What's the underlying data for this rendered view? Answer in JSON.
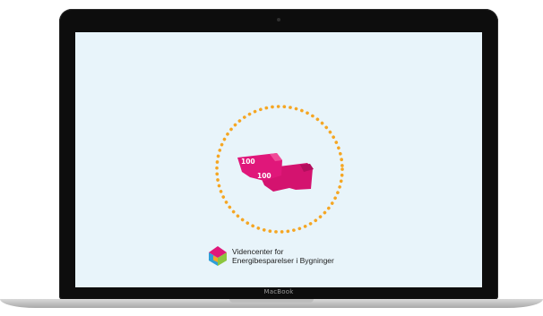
{
  "device": {
    "brand_label": "MacBook"
  },
  "slide": {
    "banknote_front_value": "100",
    "banknote_back_value": "100"
  },
  "logo": {
    "line1": "Videncenter for",
    "line2": "Energibesparelser i Bygninger"
  },
  "colors": {
    "screen_background": "#e8f4fa",
    "dotted_circle": "#f5a623",
    "banknote": "#e0177a"
  },
  "icons": [
    "dotted-circle-icon",
    "banknotes-icon",
    "house-logo-icon"
  ]
}
